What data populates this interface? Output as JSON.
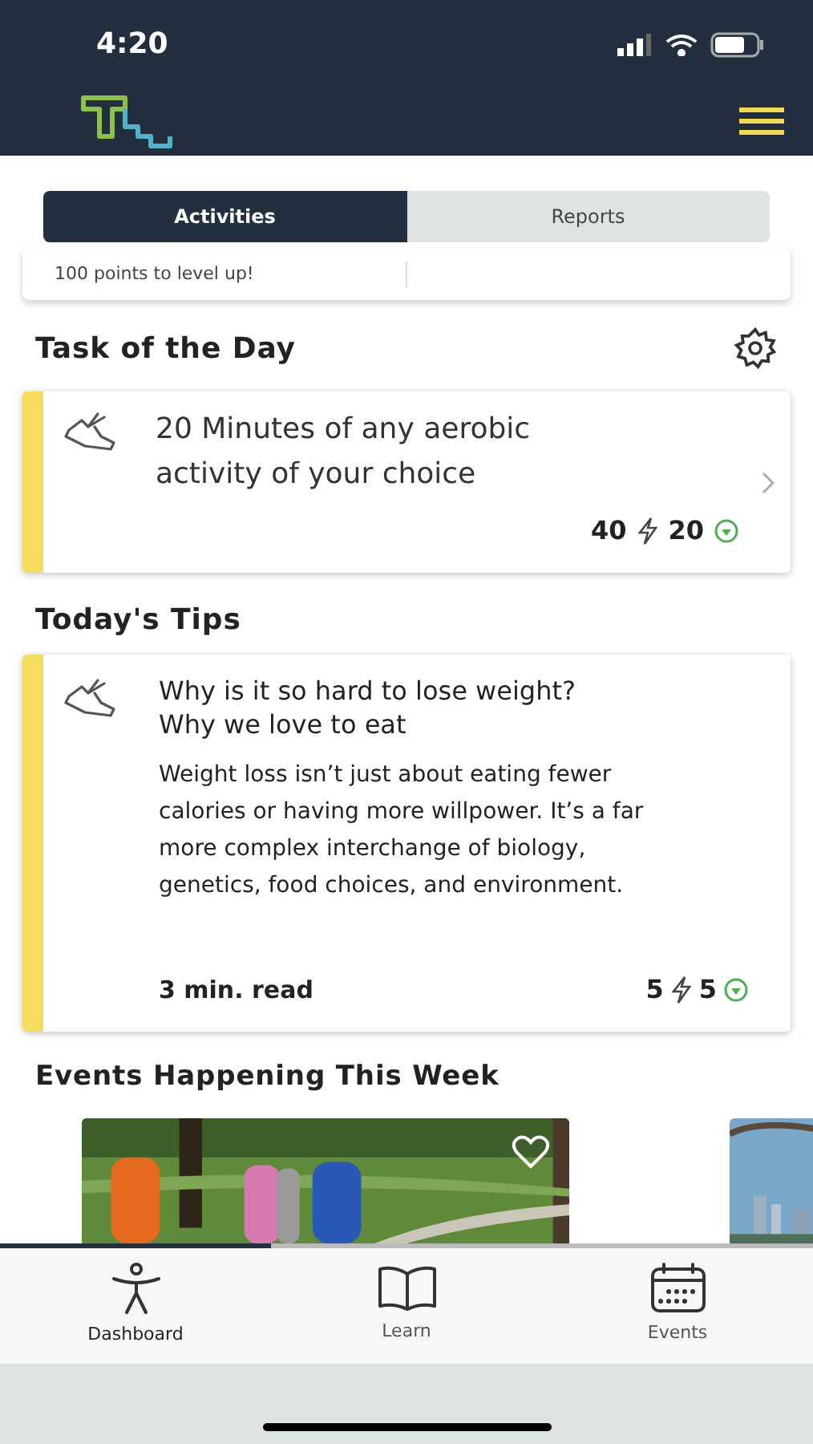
{
  "status_bar": {
    "time": "4:20"
  },
  "tabs": [
    {
      "label": "Activities",
      "selected": true
    },
    {
      "label": "Reports",
      "selected": false
    }
  ],
  "level_card": {
    "text": "100 points to level up!"
  },
  "task_of_the_day": {
    "heading": "Task of the Day",
    "title": "20 Minutes of any aerobic activity of your choice",
    "points": "40",
    "coins": "20"
  },
  "todays_tips": {
    "heading": "Today's Tips",
    "title": "Why is it so hard to lose weight? Why we love to eat",
    "body": "Weight loss isn’t just about eating fewer calories or having more willpower. It’s a far more complex interchange of biology, genetics, food choices, and environment.",
    "read_time": "3 min. read",
    "points": "5",
    "coins": "5"
  },
  "events": {
    "heading": "Events Happening This Week"
  },
  "bottom_nav": [
    {
      "label": "Dashboard",
      "selected": true
    },
    {
      "label": "Learn",
      "selected": false
    },
    {
      "label": "Events",
      "selected": false
    }
  ]
}
